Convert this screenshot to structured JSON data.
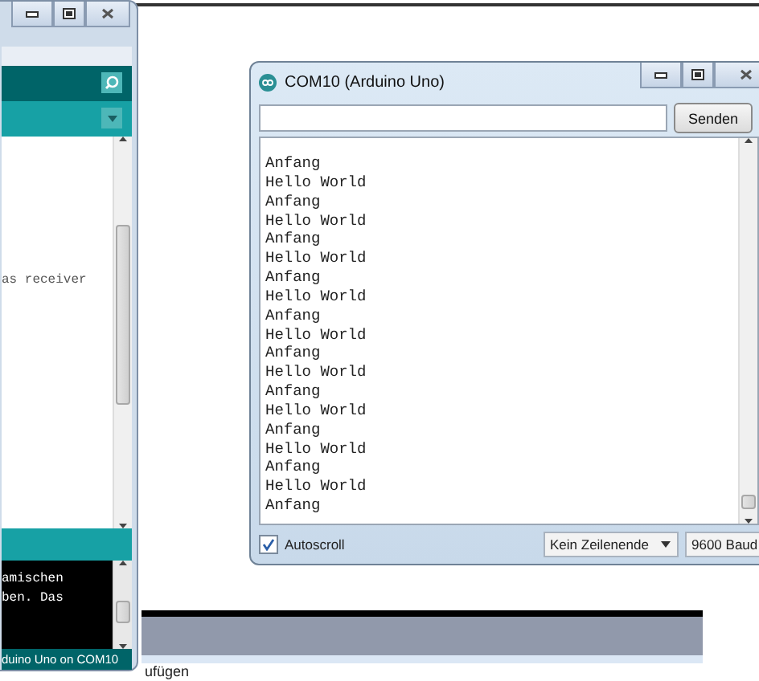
{
  "ide_window": {
    "editor_lines": [
      "as receiver"
    ],
    "console_lines": [
      "amischen",
      "ben. Das"
    ],
    "status": "duino Uno on COM10"
  },
  "serial_monitor": {
    "title": "COM10 (Arduino Uno)",
    "send_button": "Senden",
    "output_lines": [
      "Anfang",
      "Hello World",
      "Anfang",
      "Hello World",
      "Anfang",
      "Hello World",
      "Anfang",
      "Hello World",
      "Anfang",
      "Hello World",
      "Anfang",
      "Hello World",
      "Anfang",
      "Hello World",
      "Anfang",
      "Hello World",
      "Anfang",
      "Hello World",
      "Anfang"
    ],
    "autoscroll": {
      "label": "Autoscroll",
      "checked": true
    },
    "line_ending": "Kein Zeilenende",
    "baud": "9600 Baud"
  },
  "background_text": "ufügen"
}
